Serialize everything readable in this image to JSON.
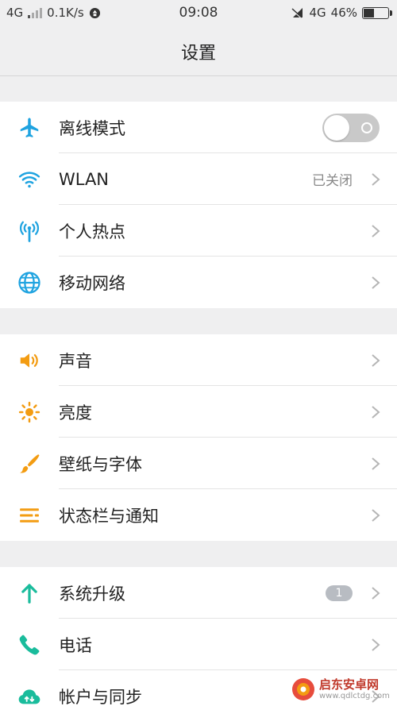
{
  "status_bar": {
    "network_left": "4G",
    "speed": "0.1K/s",
    "time": "09:08",
    "network_right": "4G",
    "battery_text": "46%",
    "battery_level": 0.46
  },
  "header": {
    "title": "设置"
  },
  "groups": [
    {
      "items": [
        {
          "label": "离线模式",
          "icon": "airplane-icon",
          "control": "toggle",
          "toggle_on": false
        },
        {
          "label": "WLAN",
          "icon": "wifi-icon",
          "value": "已关闭"
        },
        {
          "label": "个人热点",
          "icon": "hotspot-icon"
        },
        {
          "label": "移动网络",
          "icon": "globe-icon"
        }
      ]
    },
    {
      "items": [
        {
          "label": "声音",
          "icon": "speaker-icon"
        },
        {
          "label": "亮度",
          "icon": "sun-icon"
        },
        {
          "label": "壁纸与字体",
          "icon": "brush-icon"
        },
        {
          "label": "状态栏与通知",
          "icon": "list-icon"
        }
      ]
    },
    {
      "items": [
        {
          "label": "系统升级",
          "icon": "arrow-up-icon",
          "badge": "1"
        },
        {
          "label": "电话",
          "icon": "phone-icon"
        },
        {
          "label": "帐户与同步",
          "icon": "cloud-sync-icon"
        }
      ]
    }
  ],
  "watermark": {
    "title": "启东安卓网",
    "url": "www.qdlctdg.com"
  },
  "colors": {
    "blue": "#1fa3e0",
    "orange": "#f39c12",
    "green": "#1abc9c",
    "toggle_off": "#c9c9c9",
    "badge": "#b8bcc2"
  }
}
